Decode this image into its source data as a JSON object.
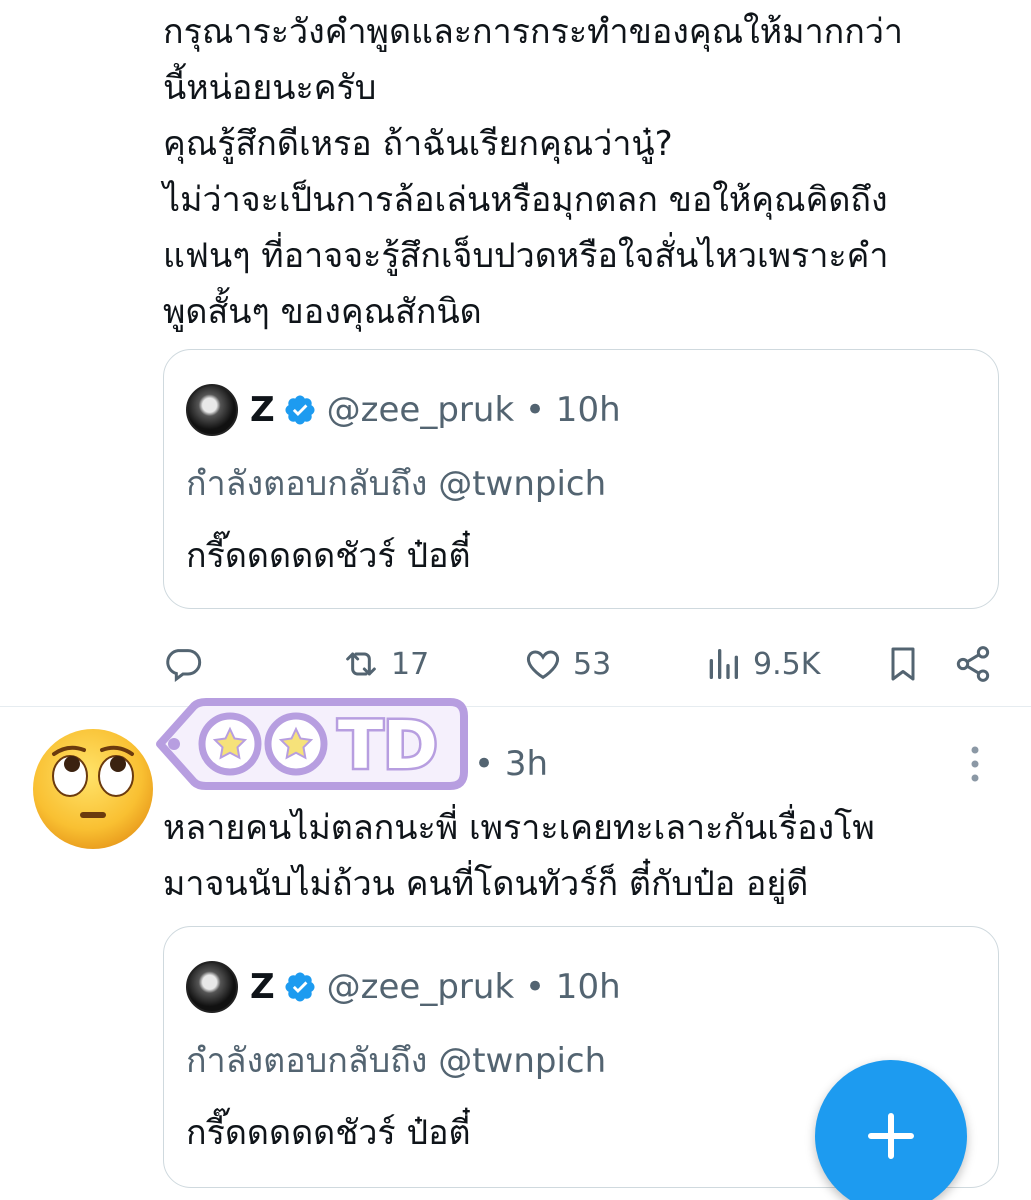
{
  "tweet1": {
    "text": "กรุณาระวังคำพูดและการกระทำของคุณให้มากกว่า\nนี้หน่อยนะครับ\nคุณรู้สึกดีเหรอ ถ้าฉันเรียกคุณว่านู๋?\nไม่ว่าจะเป็นการล้อเล่นหรือมุกตลก ขอให้คุณคิดถึง\nแฟนๆ ที่อาจจะรู้สึกเจ็บปวดหรือใจสั่นไหวเพราะคำ\nพูดสั้นๆ ของคุณสักนิด",
    "quote": {
      "name": "Z",
      "handle_time": "@zee_pruk • 10h",
      "reply_to": "กำลังตอบกลับถึง @twnpich",
      "body": "กรี๊ดดดดดชัวร์ ป๋อตี๋"
    },
    "actions": {
      "reply_count": "",
      "retweet_count": "17",
      "like_count": "53",
      "views_count": "9.5K"
    }
  },
  "tweet2": {
    "sticker_text": "TD",
    "time": "• 3h",
    "text": "หลายคนไม่ตลกนะพี่ เพราะเคยทะเลาะกันเรื่องโพ\nมาจนนับไม่ถ้วน คนที่โดนทัวร์ก็ ตี๋กับป๋อ อยู่ดี",
    "quote": {
      "name": "Z",
      "handle_time": "@zee_pruk • 10h",
      "reply_to": "กำลังตอบกลับถึง @twnpich",
      "body": "กรี๊ดดดดดชัวร์ ป๋อตี๋"
    }
  },
  "colors": {
    "accent": "#1d9bf0",
    "muted": "#536471",
    "text": "#0f1419",
    "border": "#cfd9de",
    "sticker": "#b79ee0"
  },
  "icons": [
    "reply-icon",
    "retweet-icon",
    "like-icon",
    "views-icon",
    "bookmark-icon",
    "share-icon",
    "verified-icon",
    "more-icon",
    "compose-plus-icon",
    "eye-roll-emoji",
    "star-icon"
  ]
}
